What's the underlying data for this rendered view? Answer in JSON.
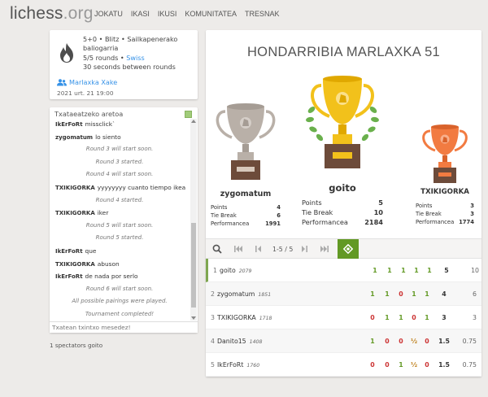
{
  "header": {
    "logo_main": "lichess",
    "logo_suffix": ".org",
    "nav": [
      "JOKATU",
      "IKASI",
      "IKUSI",
      "KOMUNITATEA",
      "TRESNAK"
    ]
  },
  "info": {
    "line1": "5+0 • Blitz • Sailkapenerako",
    "line2": "baliogarria",
    "rounds": "5/5 rounds • ",
    "system": "Swiss",
    "interval": "30 seconds between rounds",
    "organizer": "Marlaxka Xake",
    "date": "2021 urt. 21 19:00"
  },
  "chat": {
    "title": "Txataeatzeko aretoa",
    "placeholder": "Txatean txintxo mesedez!",
    "lines": [
      {
        "type": "msg",
        "user": "IkErFoRt",
        "text": "missclick`"
      },
      {
        "type": "msg",
        "user": "zygomatum",
        "text": "lo siento"
      },
      {
        "type": "sys",
        "text": "Round 3 will start soon."
      },
      {
        "type": "sys",
        "text": "Round 3 started."
      },
      {
        "type": "sys",
        "text": "Round 4 will start soon."
      },
      {
        "type": "msg",
        "user": "TXIKIGORKA",
        "text": "yyyyyyyy cuanto tiempo ikea"
      },
      {
        "type": "sys",
        "text": "Round 4 started."
      },
      {
        "type": "msg",
        "user": "TXIKIGORKA",
        "text": "iker"
      },
      {
        "type": "sys",
        "text": "Round 5 will start soon."
      },
      {
        "type": "sys",
        "text": "Round 5 started."
      },
      {
        "type": "msg",
        "user": "IkErFoRt",
        "text": "que"
      },
      {
        "type": "msg",
        "user": "TXIKIGORKA",
        "text": "abuson"
      },
      {
        "type": "msg",
        "user": "IkErFoRt",
        "text": "de nada por serlo"
      },
      {
        "type": "sys",
        "text": "Round 6 will start soon."
      },
      {
        "type": "sys",
        "text": "All possible pairings were played."
      },
      {
        "type": "sys",
        "text": "Tournament completed!"
      }
    ],
    "spectators": "1 spectators goito"
  },
  "tournament": {
    "title": "HONDARRIBIA MARLAXKA 51",
    "labels": {
      "points": "Points",
      "tiebreak": "Tie Break",
      "performance": "Performancea"
    },
    "podium": [
      {
        "place": "2",
        "name": "zygomatum",
        "points": "4",
        "tiebreak": "6",
        "performance": "1991",
        "color": "#b9b0a8"
      },
      {
        "place": "1",
        "name": "goito",
        "points": "5",
        "tiebreak": "10",
        "performance": "2184",
        "color": "#f2c11b"
      },
      {
        "place": "3",
        "name": "TXIKIGORKA",
        "points": "3",
        "tiebreak": "3",
        "performance": "1774",
        "color": "#f27b41"
      }
    ],
    "pager": "1-5 / 5",
    "standings": [
      {
        "rank": "1",
        "name": "goito",
        "rating": "2079",
        "scores": [
          "1",
          "1",
          "1",
          "1",
          "1"
        ],
        "total": "5",
        "tb": "10"
      },
      {
        "rank": "2",
        "name": "zygomatum",
        "rating": "1851",
        "scores": [
          "1",
          "1",
          "0",
          "1",
          "1"
        ],
        "total": "4",
        "tb": "6"
      },
      {
        "rank": "3",
        "name": "TXIKIGORKA",
        "rating": "1718",
        "scores": [
          "0",
          "1",
          "1",
          "0",
          "1"
        ],
        "total": "3",
        "tb": "3"
      },
      {
        "rank": "4",
        "name": "Danito15",
        "rating": "1408",
        "scores": [
          "1",
          "0",
          "0",
          "½",
          "0"
        ],
        "total": "1.5",
        "tb": "0.75"
      },
      {
        "rank": "5",
        "name": "IkErFoRt",
        "rating": "1760",
        "scores": [
          "0",
          "0",
          "1",
          "½",
          "0"
        ],
        "total": "1.5",
        "tb": "0.75"
      }
    ]
  }
}
